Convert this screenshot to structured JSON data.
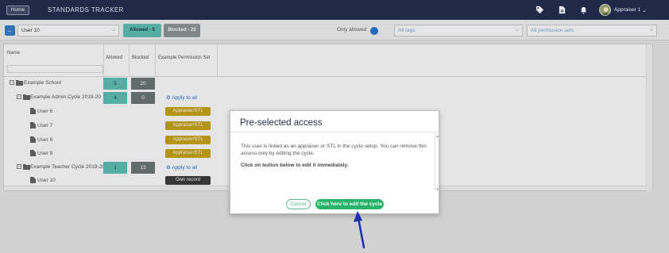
{
  "topbar": {
    "home_label": "Home",
    "app_title": "STANDARDS TRACKER",
    "icons": [
      "tag-icon",
      "document-icon",
      "bell-icon"
    ],
    "user_name": "Appraiser 1",
    "user_chevron": "⌄"
  },
  "filters": {
    "user_select": "User 10",
    "allowed_tab": "Allowed - 5",
    "blocked_tab": "Blocked - 20",
    "only_allowed_label": "Only allowed",
    "tags_placeholder": "All tags",
    "perm_placeholder": "All permission sets"
  },
  "grid": {
    "headers": {
      "name": "Name",
      "allowed": "Allowed",
      "blocked": "Blocked",
      "permission_set": "Example Permission Set"
    },
    "apply_label": "Apply to all",
    "rows": [
      {
        "kind": "school",
        "label": "Example School",
        "allowed": "5",
        "blocked": "20"
      },
      {
        "kind": "cycle",
        "label": "Example Admin Cycle 2019-20",
        "allowed": "4",
        "blocked": "0"
      },
      {
        "kind": "user",
        "label": "User 6",
        "badge": "Appraiser/STL"
      },
      {
        "kind": "user",
        "label": "User 7",
        "badge": "Appraiser/STL"
      },
      {
        "kind": "user",
        "label": "User 8",
        "badge": "Appraiser/STL"
      },
      {
        "kind": "user",
        "label": "User 9",
        "badge": "Appraiser/STL"
      },
      {
        "kind": "cycle",
        "label": "Example Teacher Cycle 2019-20",
        "allowed": "1",
        "blocked": "13"
      },
      {
        "kind": "user",
        "label": "User 10",
        "badge": "Own record"
      }
    ]
  },
  "modal": {
    "title": "Pre-selected access",
    "text": "This user is linked as an appraiser or STL in the cycle setup. You can remove this access only by editing the cycle.",
    "bold_text": "Click on button below to edit it immediately.",
    "cancel_label": "Cancel",
    "edit_label": "Click here to edit the cycle"
  },
  "colors": {
    "topbar": "#1e2a48",
    "allowed": "#5fc1b6",
    "blocked": "#6f7778",
    "badge": "#c9a418",
    "primary": "#27b468",
    "annotation_arrow": "#1a2fb0"
  }
}
